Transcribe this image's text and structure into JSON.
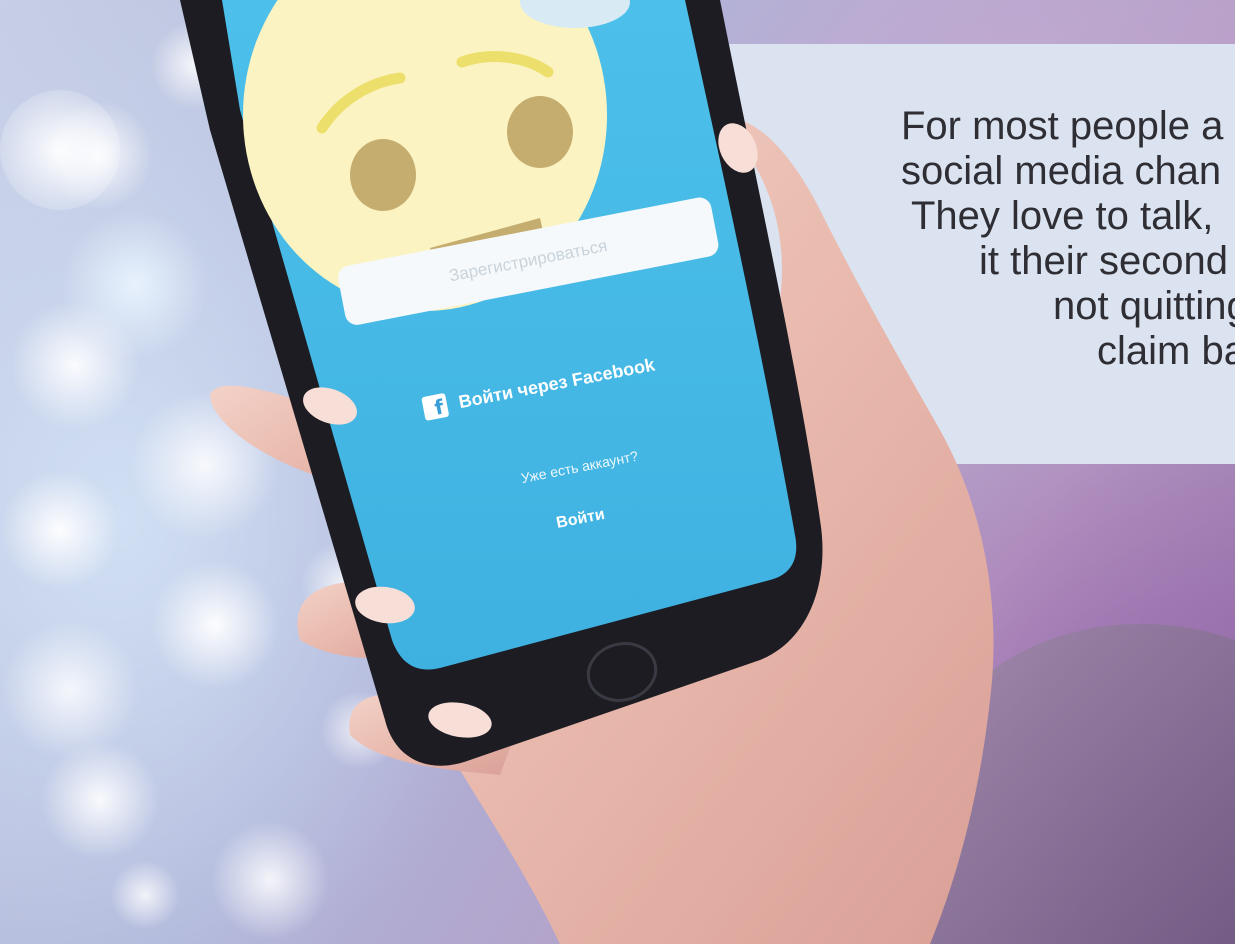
{
  "quote": {
    "lines": [
      "For most people a",
      "social media chan",
      "They love to talk,",
      "it their second",
      "not quitting",
      "claim bac"
    ]
  },
  "phone_screen": {
    "register_button": "Зарегистрироваться",
    "facebook_button": "Войти через Facebook",
    "facebook_icon_glyph": "f",
    "has_account_text": "Уже есть аккаунт?",
    "login_button": "Войти"
  },
  "colors": {
    "screen_blue": "#47b9e6",
    "quote_box": "#dbe3f1",
    "emoji_face": "#fbf3c2",
    "emoji_features": "#c5ad6f",
    "brow": "#ecdf6c"
  },
  "icons": [
    "facebook-icon",
    "home-button-icon"
  ]
}
